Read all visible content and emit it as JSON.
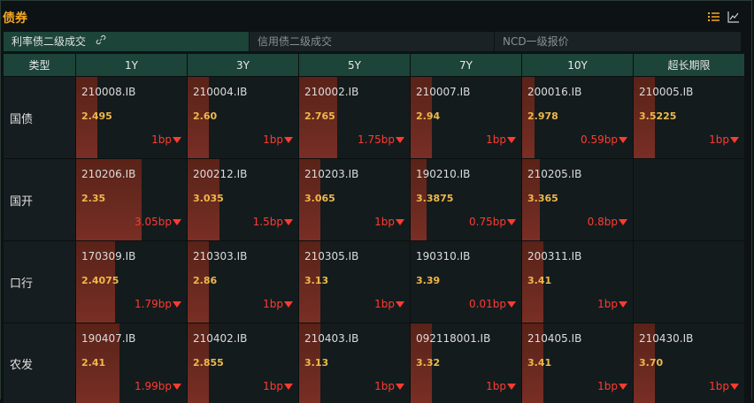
{
  "header": {
    "title": "债券",
    "icons": [
      "list-icon",
      "line-chart-icon"
    ],
    "accent_color": "#f5a623"
  },
  "tabs": [
    {
      "label": "利率债二级成交",
      "active": true
    },
    {
      "label": "信用债二级成交",
      "active": false
    },
    {
      "label": "NCD一级报价",
      "active": false
    }
  ],
  "table": {
    "corner_label": "类型",
    "columns": [
      "1Y",
      "3Y",
      "5Y",
      "7Y",
      "10Y",
      "超长期限"
    ],
    "rows": [
      {
        "label": "国债",
        "cells": [
          {
            "code": "210008.IB",
            "yield": "2.495",
            "change": "1bp",
            "direction": "down",
            "bar_fraction": 0.19
          },
          {
            "code": "210004.IB",
            "yield": "2.60",
            "change": "1bp",
            "direction": "down",
            "bar_fraction": 0.19
          },
          {
            "code": "210002.IB",
            "yield": "2.765",
            "change": "1.75bp",
            "direction": "down",
            "bar_fraction": 0.34
          },
          {
            "code": "210007.IB",
            "yield": "2.94",
            "change": "1bp",
            "direction": "down",
            "bar_fraction": 0.19
          },
          {
            "code": "200016.IB",
            "yield": "2.978",
            "change": "0.59bp",
            "direction": "down",
            "bar_fraction": 0.11
          },
          {
            "code": "210005.IB",
            "yield": "3.5225",
            "change": "1bp",
            "direction": "down",
            "bar_fraction": 0.19
          }
        ]
      },
      {
        "label": "国开",
        "cells": [
          {
            "code": "210206.IB",
            "yield": "2.35",
            "change": "3.05bp",
            "direction": "down",
            "bar_fraction": 0.59
          },
          {
            "code": "200212.IB",
            "yield": "3.035",
            "change": "1.5bp",
            "direction": "down",
            "bar_fraction": 0.29
          },
          {
            "code": "210203.IB",
            "yield": "3.065",
            "change": "1bp",
            "direction": "down",
            "bar_fraction": 0.19
          },
          {
            "code": "190210.IB",
            "yield": "3.3875",
            "change": "0.75bp",
            "direction": "down",
            "bar_fraction": 0.14
          },
          {
            "code": "210205.IB",
            "yield": "3.365",
            "change": "0.8bp",
            "direction": "down",
            "bar_fraction": 0.16
          },
          null
        ]
      },
      {
        "label": "口行",
        "cells": [
          {
            "code": "170309.IB",
            "yield": "2.4075",
            "change": "1.79bp",
            "direction": "down",
            "bar_fraction": 0.35
          },
          {
            "code": "210303.IB",
            "yield": "2.86",
            "change": "1bp",
            "direction": "down",
            "bar_fraction": 0.19
          },
          {
            "code": "210305.IB",
            "yield": "3.13",
            "change": "1bp",
            "direction": "down",
            "bar_fraction": 0.19
          },
          {
            "code": "190310.IB",
            "yield": "3.39",
            "change": "0.01bp",
            "direction": "down",
            "bar_fraction": 0.0
          },
          {
            "code": "200311.IB",
            "yield": "3.41",
            "change": "1bp",
            "direction": "down",
            "bar_fraction": 0.19
          },
          null
        ]
      },
      {
        "label": "农发",
        "cells": [
          {
            "code": "190407.IB",
            "yield": "2.41",
            "change": "1.99bp",
            "direction": "down",
            "bar_fraction": 0.39
          },
          {
            "code": "210402.IB",
            "yield": "2.855",
            "change": "1bp",
            "direction": "down",
            "bar_fraction": 0.19
          },
          {
            "code": "210403.IB",
            "yield": "3.13",
            "change": "1bp",
            "direction": "down",
            "bar_fraction": 0.19
          },
          {
            "code": "092118001.IB",
            "yield": "3.32",
            "change": "1bp",
            "direction": "down",
            "bar_fraction": 0.19
          },
          {
            "code": "210405.IB",
            "yield": "3.41",
            "change": "1bp",
            "direction": "down",
            "bar_fraction": 0.19
          },
          {
            "code": "210430.IB",
            "yield": "3.70",
            "change": "1bp",
            "direction": "down",
            "bar_fraction": 0.19
          }
        ]
      }
    ]
  },
  "colors": {
    "header_bg": "#1c4439",
    "yield": "#f0b84a",
    "change_down": "#ff3b30",
    "bar": "#6a2a20"
  }
}
